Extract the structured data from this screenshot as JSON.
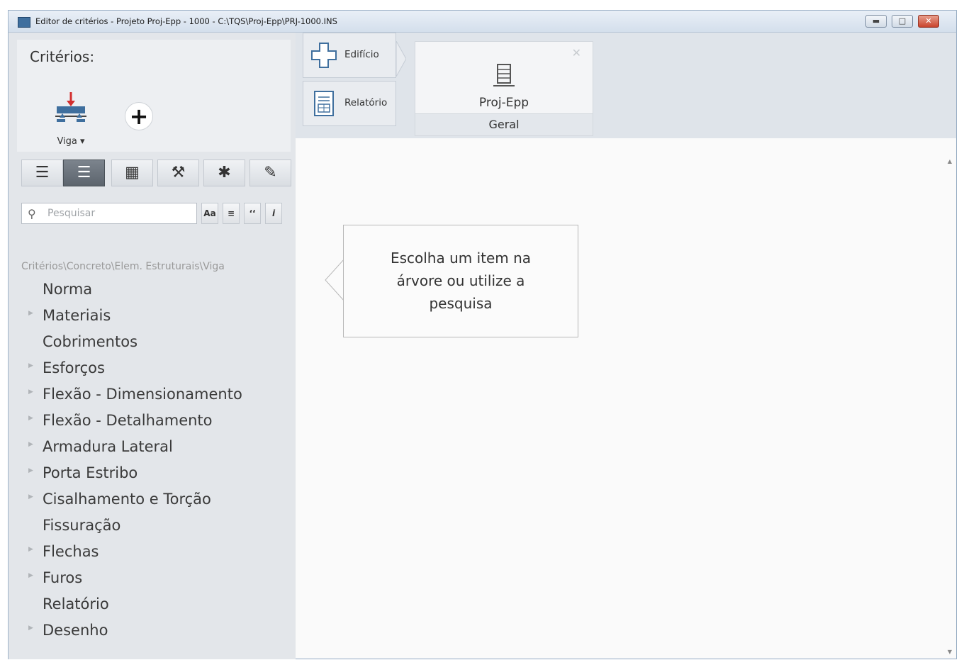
{
  "window": {
    "title": "Editor de critérios - Projeto Proj-Epp - 1000 - C:\\TQS\\Proj-Epp\\PRJ-1000.INS",
    "minimize_icon": "minimize-icon",
    "maximize_icon": "maximize-icon",
    "close_icon": "close-icon"
  },
  "criterios": {
    "title": "Critérios:",
    "type_label": "Viga",
    "type_icon": "beam-icon",
    "add_icon": "plus-icon"
  },
  "toolbar": {
    "buttons": [
      {
        "icon": "list-lines-icon",
        "active": false
      },
      {
        "icon": "list-detailed-icon",
        "active": true
      },
      {
        "icon": "list-grid-icon",
        "active": false
      },
      {
        "icon": "wrench-icon",
        "active": false
      },
      {
        "icon": "asterisk-icon",
        "active": false
      },
      {
        "icon": "pencil-icon",
        "active": false
      }
    ]
  },
  "search": {
    "placeholder": "Pesquisar",
    "icon": "search-icon",
    "options": [
      "Aa",
      "≡",
      "‘‘",
      "i"
    ]
  },
  "breadcrumb": "Critérios\\Concreto\\Elem. Estruturais\\Viga",
  "tree": {
    "items": [
      {
        "label": "Norma",
        "expandable": false
      },
      {
        "label": "Materiais",
        "expandable": true
      },
      {
        "label": "Cobrimentos",
        "expandable": false
      },
      {
        "label": "Esforços",
        "expandable": true
      },
      {
        "label": "Flexão - Dimensionamento",
        "expandable": true
      },
      {
        "label": "Flexão - Detalhamento",
        "expandable": true
      },
      {
        "label": "Armadura Lateral",
        "expandable": true
      },
      {
        "label": "Porta Estribo",
        "expandable": true
      },
      {
        "label": "Cisalhamento e Torção",
        "expandable": true
      },
      {
        "label": "Fissuração",
        "expandable": false
      },
      {
        "label": "Flechas",
        "expandable": true
      },
      {
        "label": "Furos",
        "expandable": true
      },
      {
        "label": "Relatório",
        "expandable": false
      },
      {
        "label": "Desenho",
        "expandable": true
      }
    ]
  },
  "nav": {
    "edificio": "Edifício",
    "relatorio": "Relatório"
  },
  "project": {
    "name": "Proj-Epp",
    "section": "Geral",
    "icon": "building-icon"
  },
  "tooltip": {
    "line1": "Escolha um item na",
    "line2": "árvore ou utilize a",
    "line3": "pesquisa"
  },
  "colors": {
    "accent": "#d32f2f",
    "active_button": "#646c75"
  }
}
